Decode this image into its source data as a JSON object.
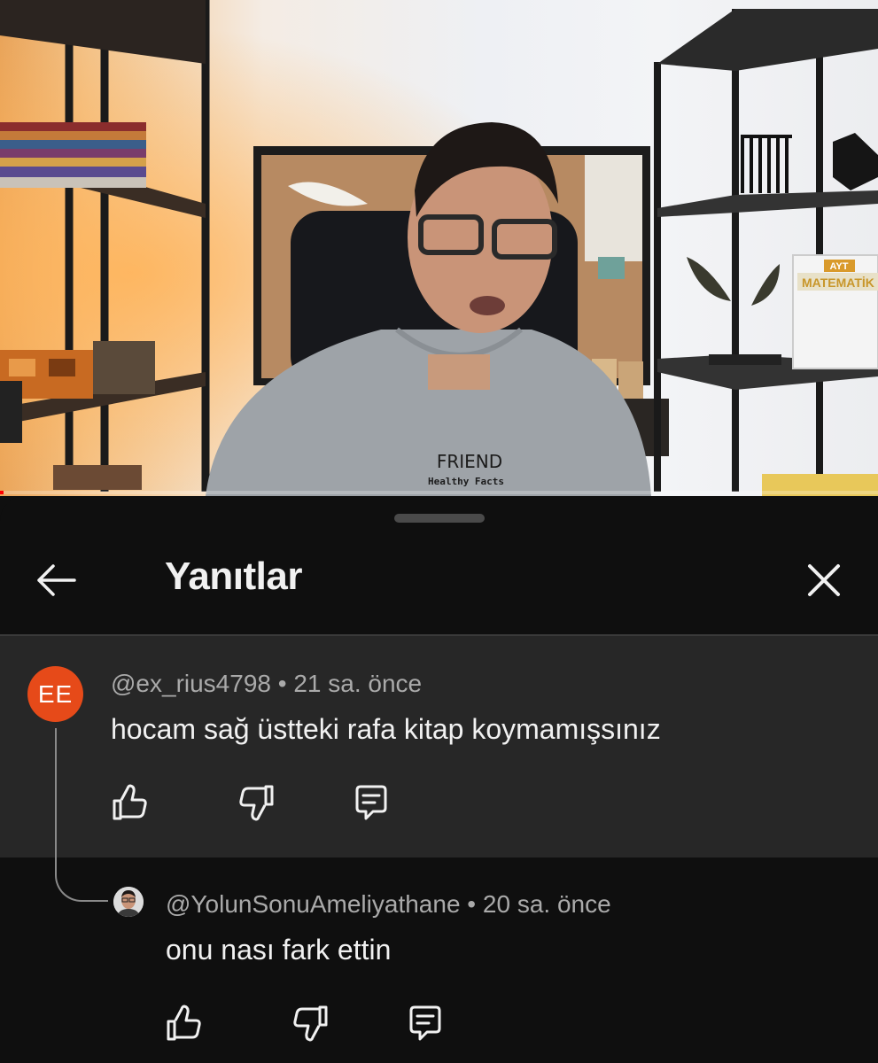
{
  "video": {
    "shirt_print_title": "FRIEND",
    "shirt_print_subtitle": "Healthy Facts",
    "book_label_top": "AYT",
    "book_label_title": "MATEMATİK",
    "progress_fraction": 0.004
  },
  "panel": {
    "title": "Yanıtlar",
    "back_icon": "arrow-left-icon",
    "close_icon": "close-icon"
  },
  "comments": [
    {
      "avatar_initials": "EE",
      "avatar_color": "#e64a19",
      "author": "@ex_rius4798",
      "time": "21 sa. önce",
      "text": "hocam sağ üstteki rafa kitap koymamışsınız",
      "actions": [
        "like-icon",
        "dislike-icon",
        "reply-icon"
      ]
    },
    {
      "avatar_icon": "user-photo-avatar",
      "author": "@YolunSonuAmeliyathane",
      "time": "20 sa. önce",
      "text": "onu nası fark ettin",
      "actions": [
        "like-icon",
        "dislike-icon",
        "reply-icon"
      ]
    }
  ],
  "separator": "•",
  "colors": {
    "sheet_background": "#0f0f0f",
    "highlight_comment_background": "#272727",
    "meta_text": "#aaaaaa",
    "primary_text": "#f1f1f1"
  }
}
